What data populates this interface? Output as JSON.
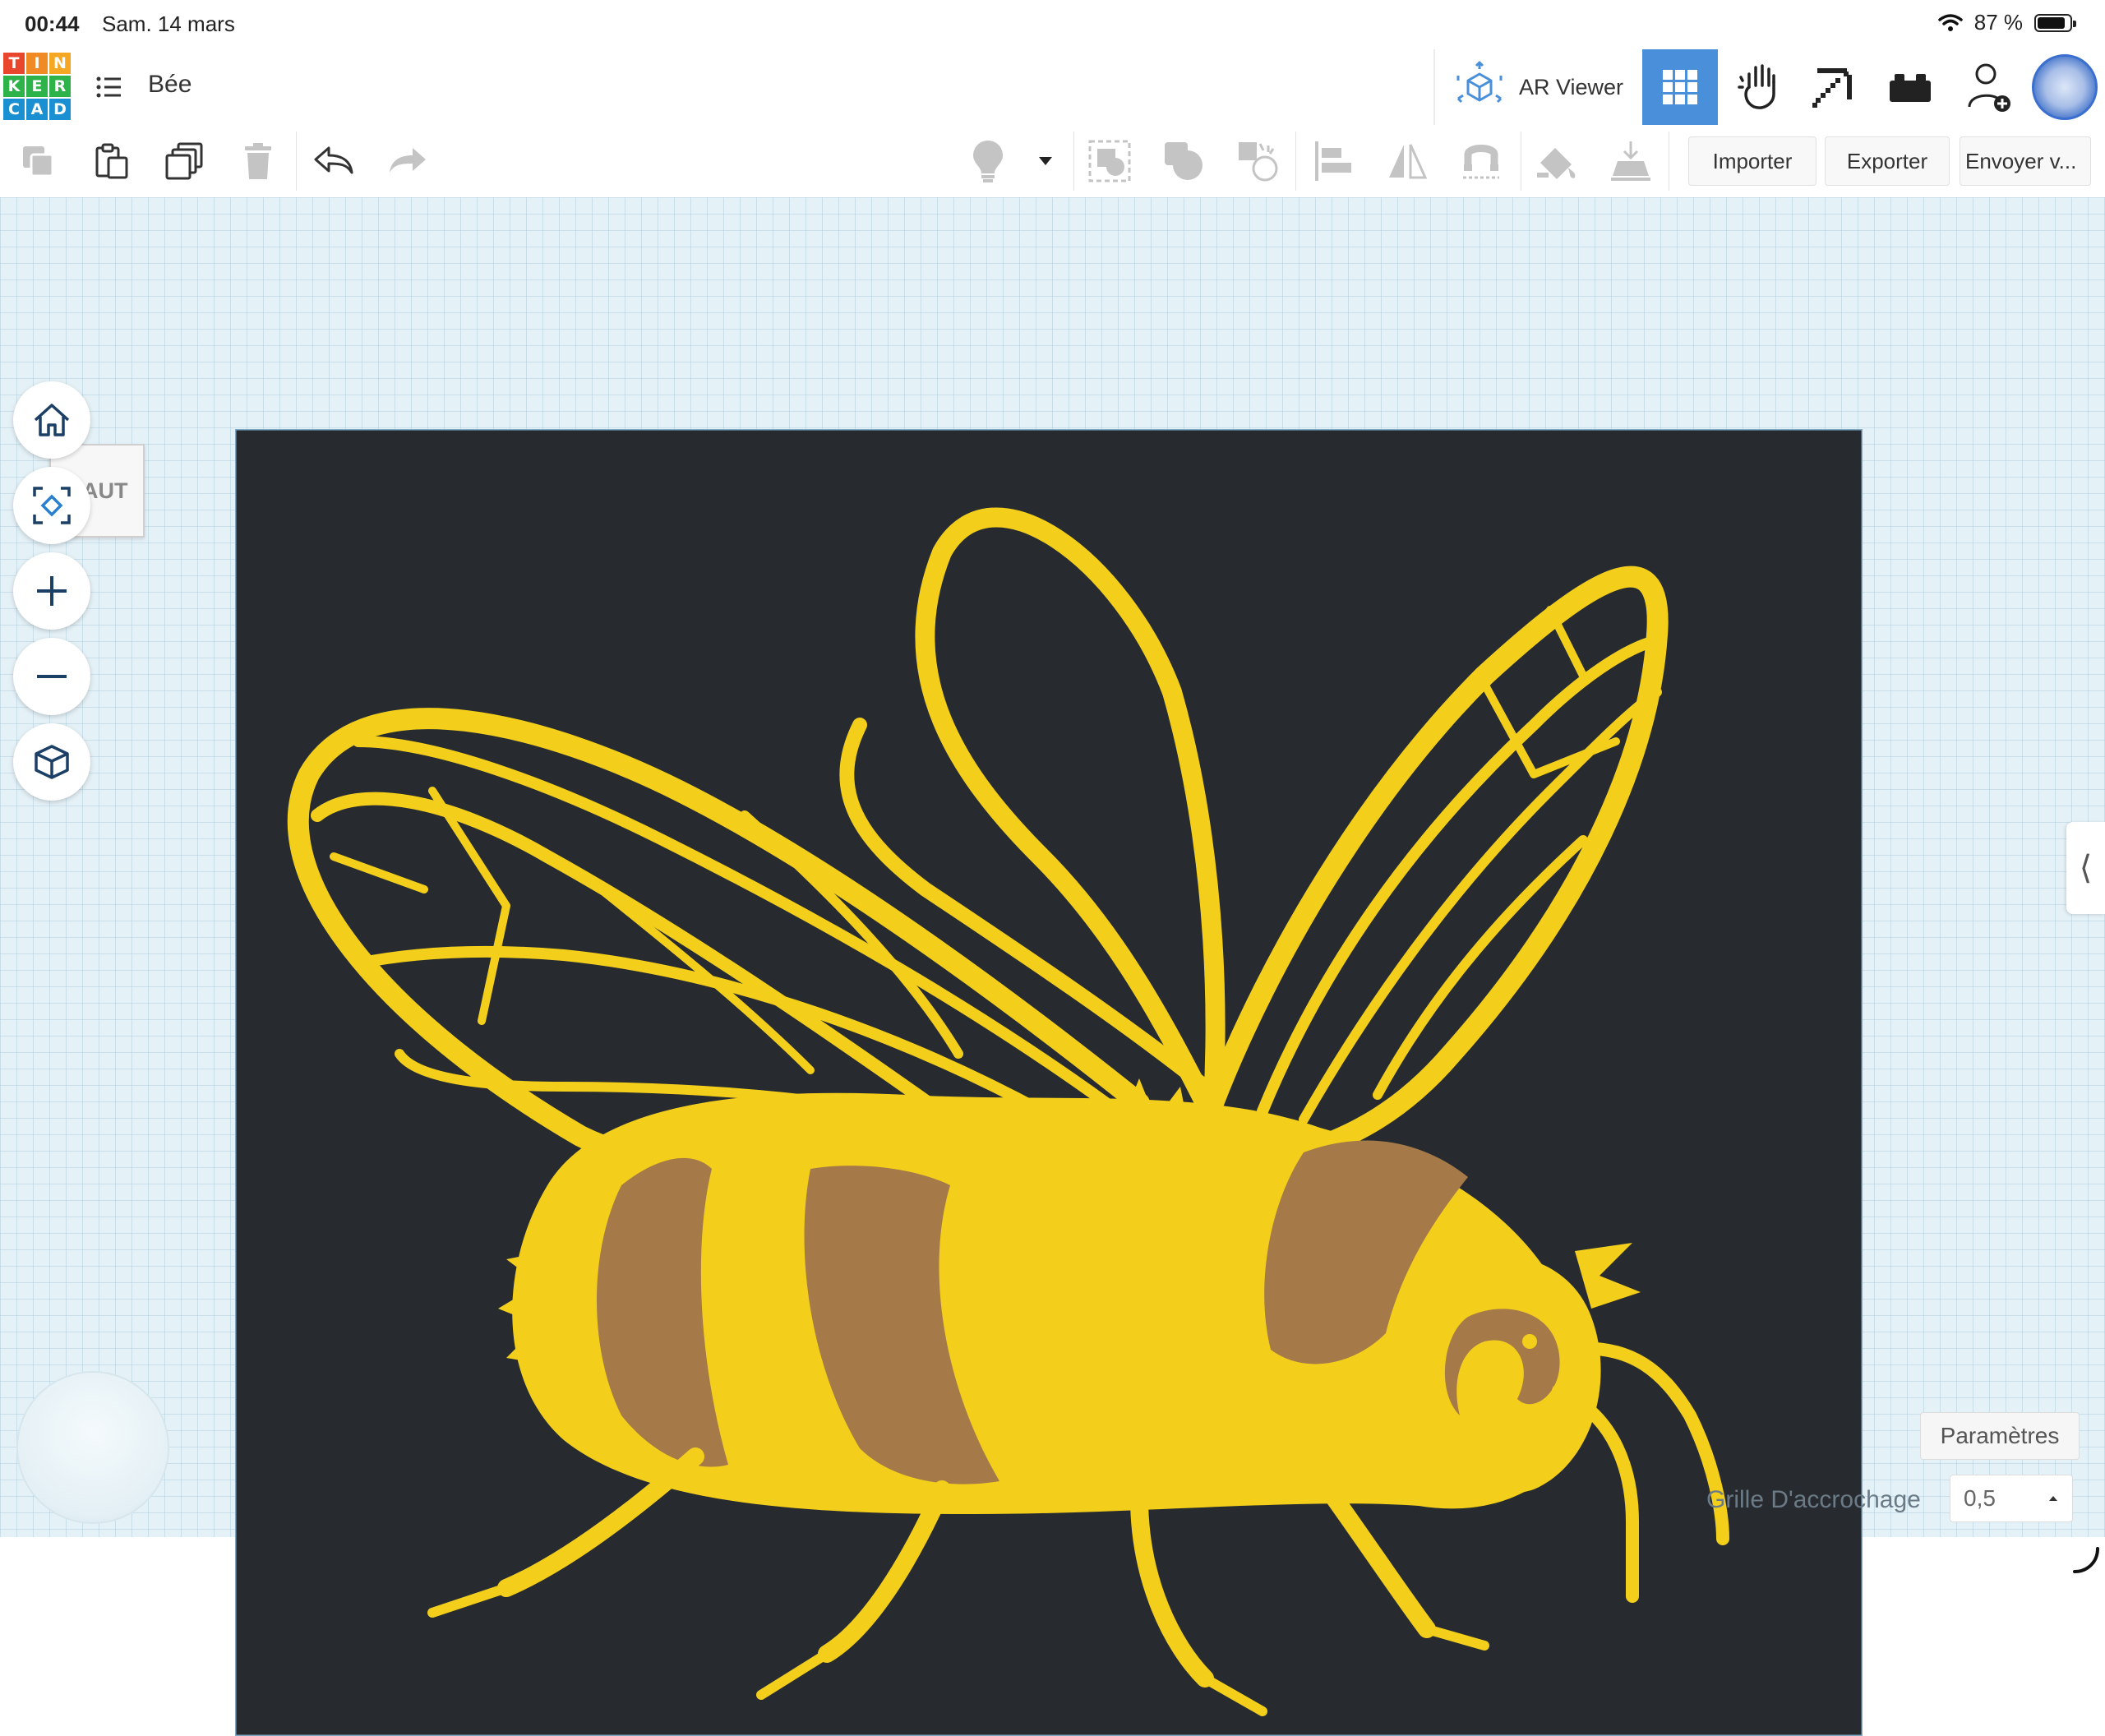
{
  "status_bar": {
    "time": "00:44",
    "date": "Sam. 14 mars",
    "battery": "87 %"
  },
  "header": {
    "logo_letters": [
      "T",
      "I",
      "N",
      "K",
      "E",
      "R",
      "C",
      "A",
      "D"
    ],
    "logo_colors": [
      "#e8472e",
      "#e8472e",
      "#e8472e",
      "#2db34a",
      "#2db34a",
      "#2db34a",
      "#1a8fd1",
      "#1a8fd1",
      "#1a8fd1"
    ],
    "project_title": "Bée",
    "ar_viewer_label": "AR Viewer",
    "view_buttons": [
      "grid-view-icon",
      "tinker-hand-icon",
      "pickaxe-icon",
      "brick-icon",
      "add-user-icon"
    ],
    "active_view": "grid-view-icon"
  },
  "toolbar": {
    "import_label": "Importer",
    "export_label": "Exporter",
    "send_label": "Envoyer v..."
  },
  "workplane": {
    "view_cube_label": "HAUT",
    "settings_label": "Paramètres",
    "snap_grid_label": "Grille D'accrochage",
    "snap_grid_value": "0,5"
  },
  "colors": {
    "accent": "#4a8fd9",
    "plate": "#272b2f",
    "bee_yellow": "#f3cf1c",
    "bee_brown": "#a57a48",
    "grid_bg": "#e4f1f7"
  }
}
